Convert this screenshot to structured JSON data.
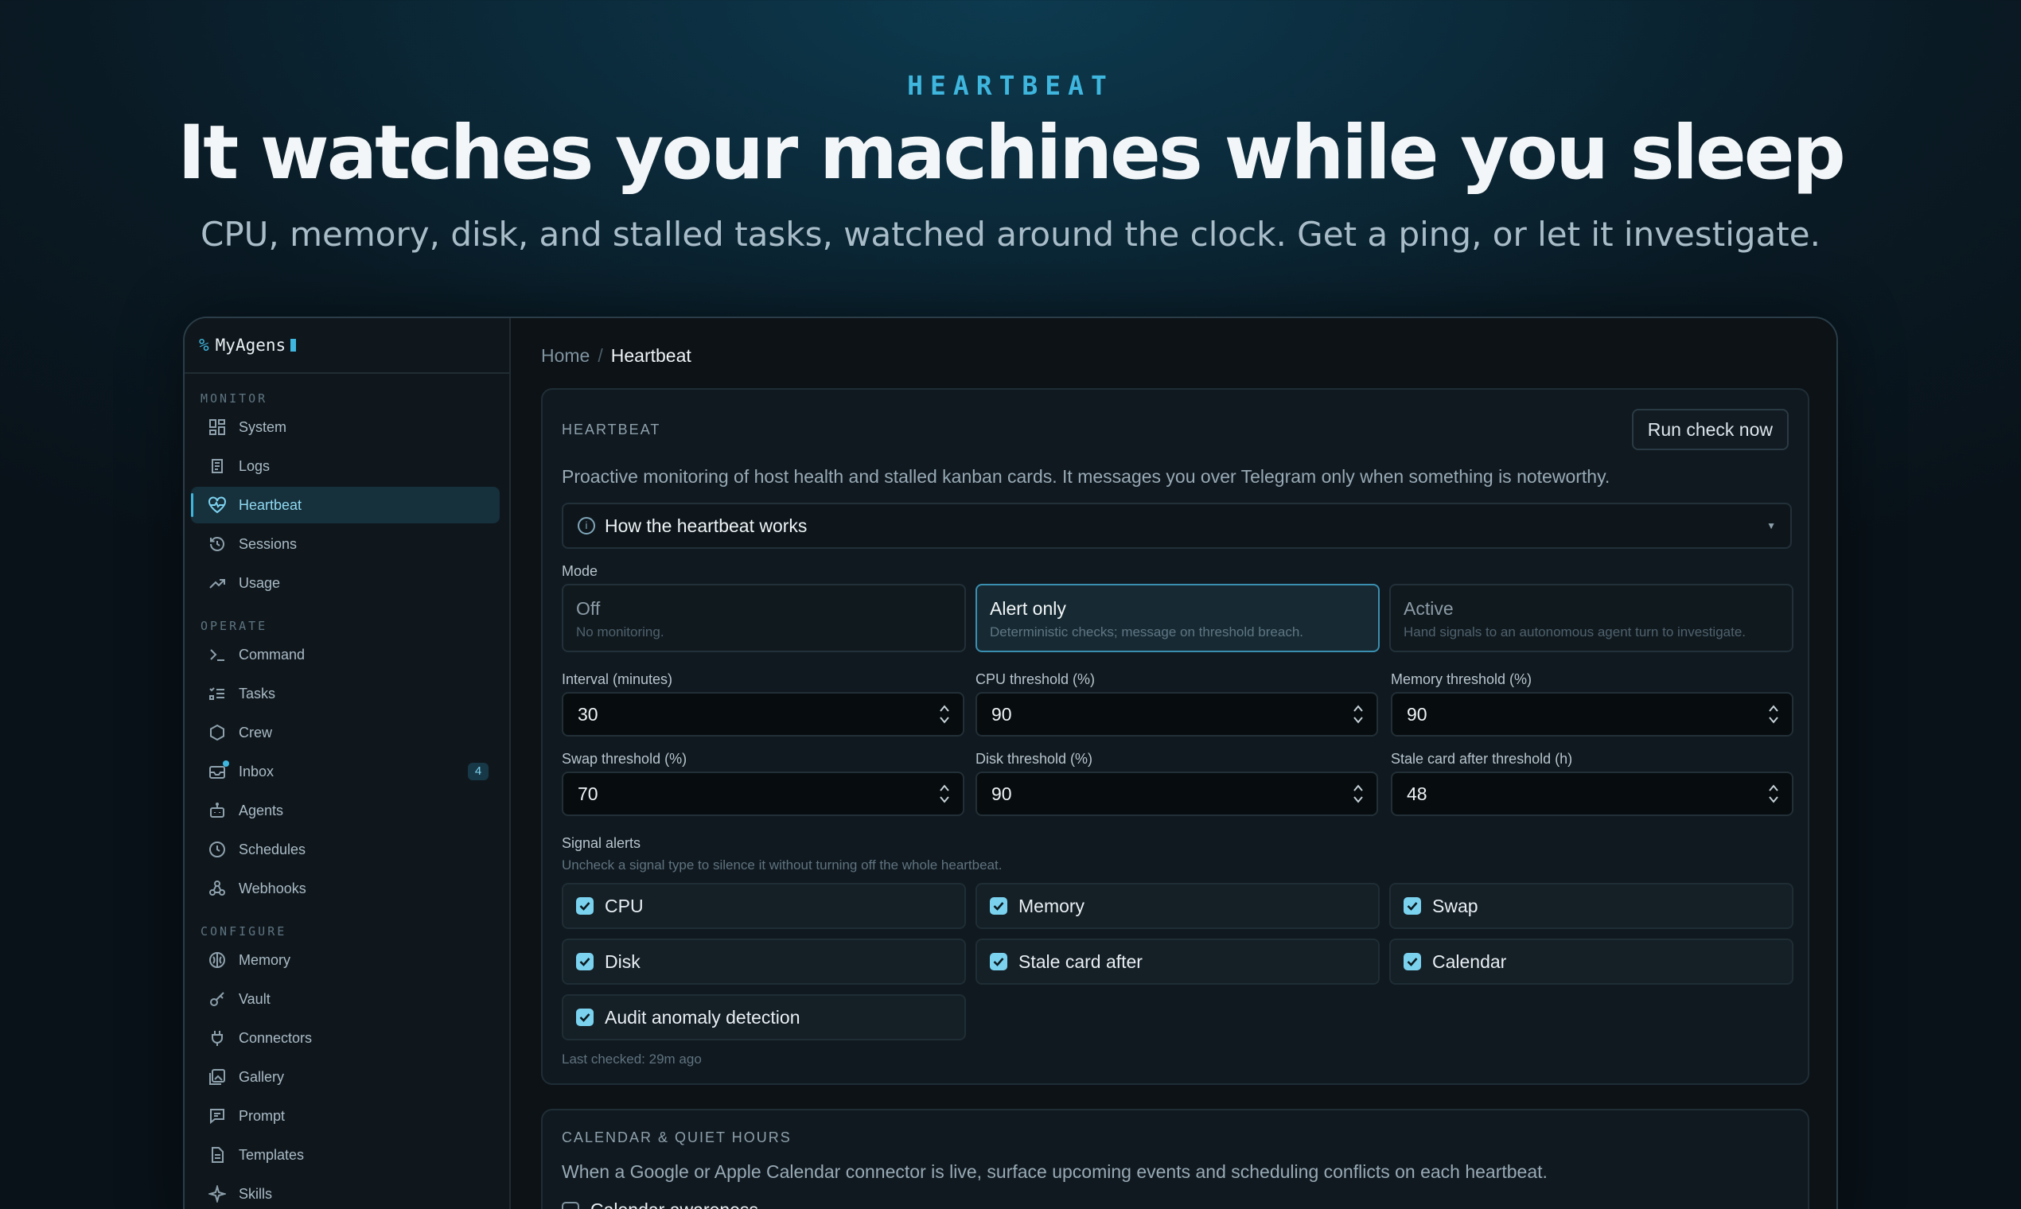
{
  "hero": {
    "eyebrow": "HEARTBEAT",
    "headline": "It watches your machines while you sleep",
    "subline": "CPU, memory, disk, and stalled tasks, watched around the clock. Get a ping, or let it investigate."
  },
  "brand": {
    "prefix": "%",
    "name": "MyAgens"
  },
  "sidebar": {
    "monitor_label": "MONITOR",
    "monitor": [
      {
        "label": "System",
        "icon": "grid-icon"
      },
      {
        "label": "Logs",
        "icon": "scroll-icon"
      },
      {
        "label": "Heartbeat",
        "icon": "heart-pulse-icon",
        "active": true
      },
      {
        "label": "Sessions",
        "icon": "history-icon"
      },
      {
        "label": "Usage",
        "icon": "trend-up-icon"
      }
    ],
    "operate_label": "OPERATE",
    "operate": [
      {
        "label": "Command",
        "icon": "terminal-icon"
      },
      {
        "label": "Tasks",
        "icon": "list-check-icon"
      },
      {
        "label": "Crew",
        "icon": "hexagon-icon"
      },
      {
        "label": "Inbox",
        "icon": "inbox-icon",
        "badge": "4"
      },
      {
        "label": "Agents",
        "icon": "bot-icon"
      },
      {
        "label": "Schedules",
        "icon": "clock-icon"
      },
      {
        "label": "Webhooks",
        "icon": "webhook-icon"
      }
    ],
    "configure_label": "CONFIGURE",
    "configure": [
      {
        "label": "Memory",
        "icon": "brain-icon"
      },
      {
        "label": "Vault",
        "icon": "key-icon"
      },
      {
        "label": "Connectors",
        "icon": "plug-icon"
      },
      {
        "label": "Gallery",
        "icon": "gallery-icon"
      },
      {
        "label": "Prompt",
        "icon": "message-icon"
      },
      {
        "label": "Templates",
        "icon": "file-icon"
      },
      {
        "label": "Skills",
        "icon": "sparkle-icon"
      }
    ]
  },
  "breadcrumb": {
    "home": "Home",
    "current": "Heartbeat"
  },
  "heartbeat": {
    "title": "HEARTBEAT",
    "run_button": "Run check now",
    "description": "Proactive monitoring of host health and stalled kanban cards. It messages you over Telegram only when something is noteworthy.",
    "accordion_title": "How the heartbeat works",
    "mode_label": "Mode",
    "modes": [
      {
        "title": "Off",
        "sub": "No monitoring."
      },
      {
        "title": "Alert only",
        "sub": "Deterministic checks; message on threshold breach.",
        "selected": true
      },
      {
        "title": "Active",
        "sub": "Hand signals to an autonomous agent turn to investigate."
      }
    ],
    "fields": [
      {
        "label": "Interval (minutes)",
        "value": "30"
      },
      {
        "label": "CPU threshold (%)",
        "value": "90"
      },
      {
        "label": "Memory threshold (%)",
        "value": "90"
      },
      {
        "label": "Swap threshold (%)",
        "value": "70"
      },
      {
        "label": "Disk threshold (%)",
        "value": "90"
      },
      {
        "label": "Stale card after threshold (h)",
        "value": "48"
      }
    ],
    "signal_label": "Signal alerts",
    "signal_hint": "Uncheck a signal type to silence it without turning off the whole heartbeat.",
    "signals": [
      {
        "label": "CPU",
        "checked": true
      },
      {
        "label": "Memory",
        "checked": true
      },
      {
        "label": "Swap",
        "checked": true
      },
      {
        "label": "Disk",
        "checked": true
      },
      {
        "label": "Stale card after",
        "checked": true
      },
      {
        "label": "Calendar",
        "checked": true
      },
      {
        "label": "Audit anomaly detection",
        "checked": true
      }
    ],
    "last_checked": "Last checked: 29m ago"
  },
  "calendar": {
    "title": "CALENDAR & QUIET HOURS",
    "description": "When a Google or Apple Calendar connector is live, surface upcoming events and scheduling conflicts on each heartbeat.",
    "checkbox_label": "Calendar awareness"
  },
  "colors": {
    "accent": "#3fb6de",
    "background": "#0c1216",
    "card": "#10191f"
  }
}
